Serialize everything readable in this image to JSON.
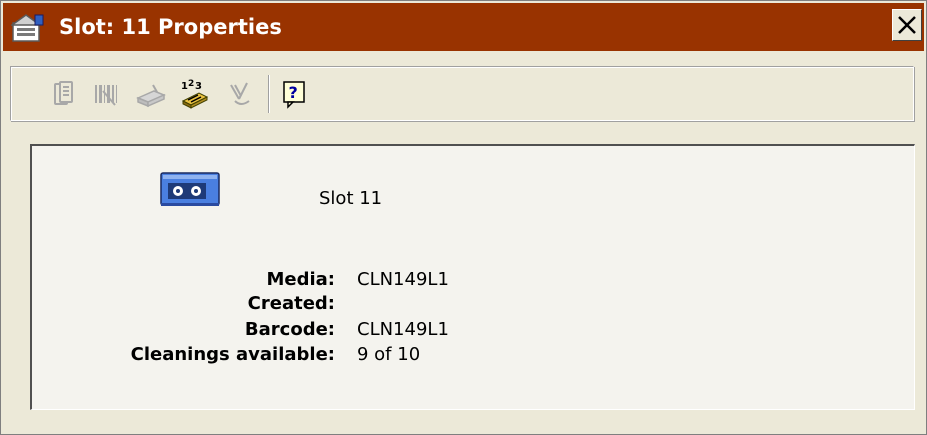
{
  "window": {
    "title": "Slot: 11 Properties",
    "close_label": "✕"
  },
  "toolbar": {
    "buttons": [
      {
        "icon": "cartridge-stack-icon",
        "enabled": false
      },
      {
        "icon": "barcode-icon",
        "enabled": false
      },
      {
        "icon": "drive-icon",
        "enabled": false
      },
      {
        "icon": "inventory-numbers-icon",
        "enabled": true
      },
      {
        "icon": "clean-brush-icon",
        "enabled": false
      },
      {
        "icon": "help-icon",
        "enabled": true
      }
    ]
  },
  "panel": {
    "slot_label": "Slot 11",
    "media_icon": "cleaning-tape-icon",
    "properties": [
      {
        "label": "Media:",
        "value": "CLN149L1"
      },
      {
        "label": "Created:",
        "value": ""
      },
      {
        "label": "Barcode:",
        "value": "CLN149L1"
      },
      {
        "label": "Cleanings available:",
        "value": "9 of 10"
      }
    ]
  },
  "colors": {
    "titlebar": "#993300",
    "window_bg": "#ece9d8",
    "panel_bg": "#f4f3ee",
    "media_icon": "#4a7fe0"
  }
}
